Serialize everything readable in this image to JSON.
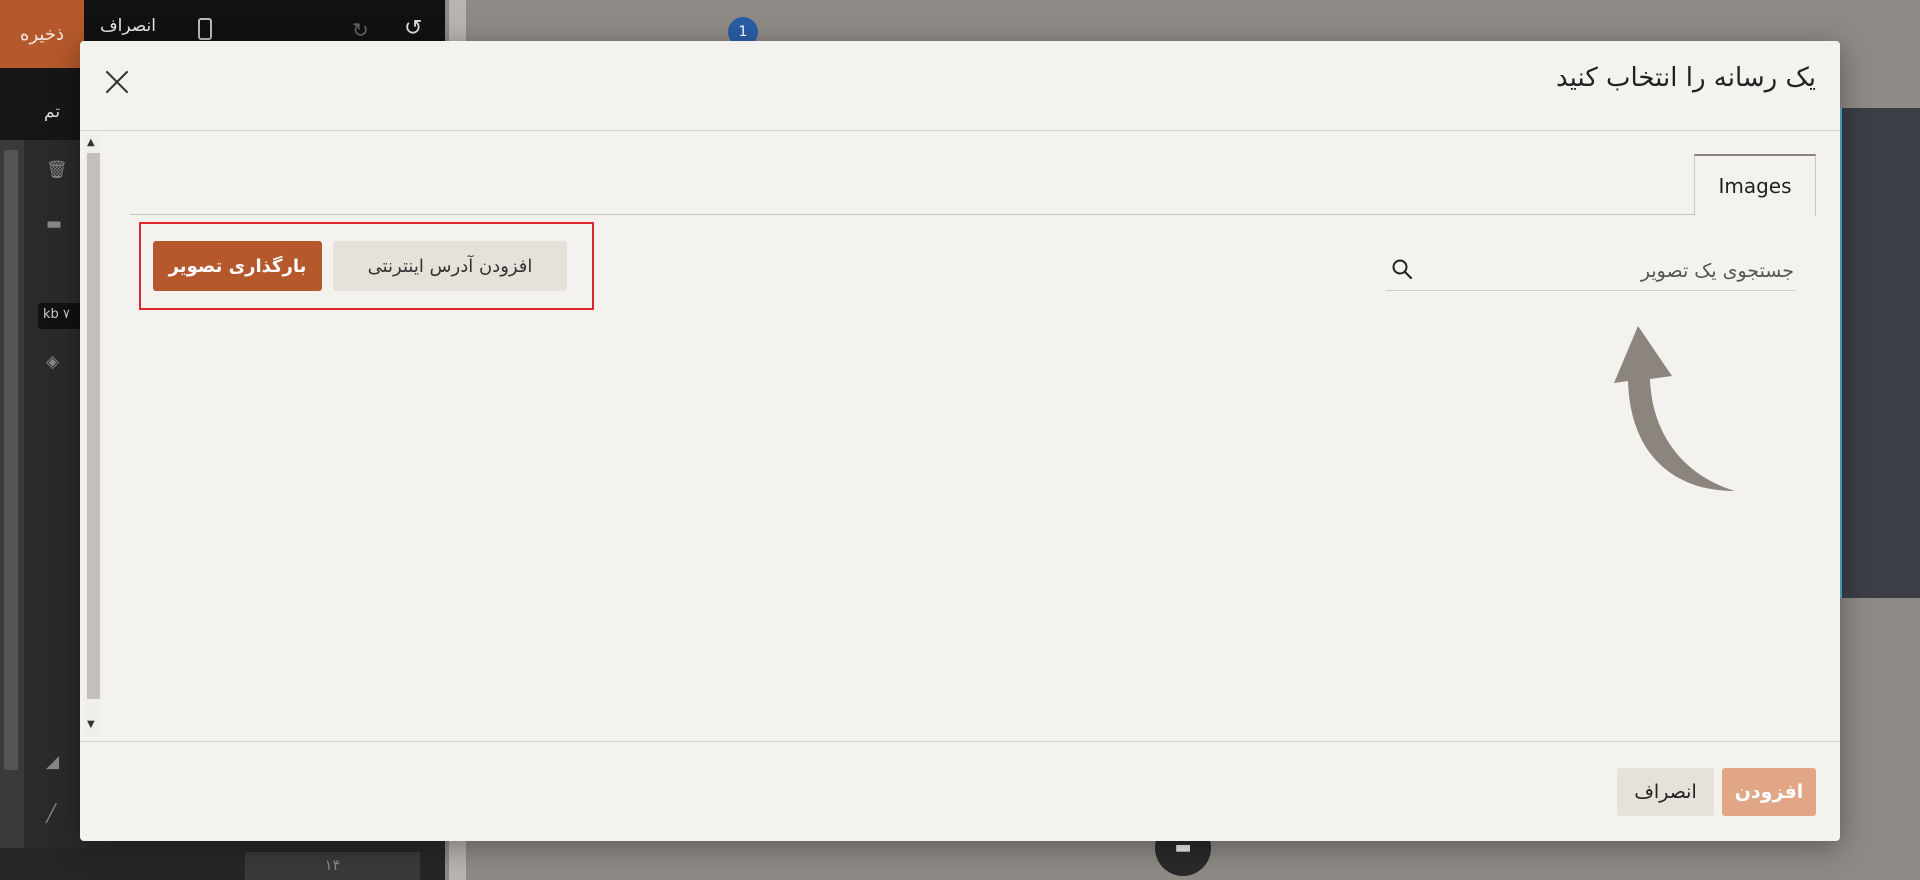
{
  "editor": {
    "save_label": "ذخیره",
    "cancel_label": "انصراف",
    "theme_label": "تم",
    "kb_tag": "kb ۷",
    "font_size": "۱۴",
    "badge": "1"
  },
  "modal": {
    "title": "یک رسانه را انتخاب کنید",
    "tabs": [
      {
        "label": "Images",
        "active": true
      }
    ],
    "upload_label": "بارگذاری تصویر",
    "add_url_label": "افزودن آدرس اینترنتی",
    "search": {
      "placeholder": "جستجوی یک تصویر",
      "value": ""
    },
    "footer": {
      "add_label": "افزودن",
      "cancel_label": "انصراف"
    }
  },
  "colors": {
    "accent": "#b5582c",
    "accent_disabled": "#e1a685",
    "highlight": "#e0262b"
  }
}
